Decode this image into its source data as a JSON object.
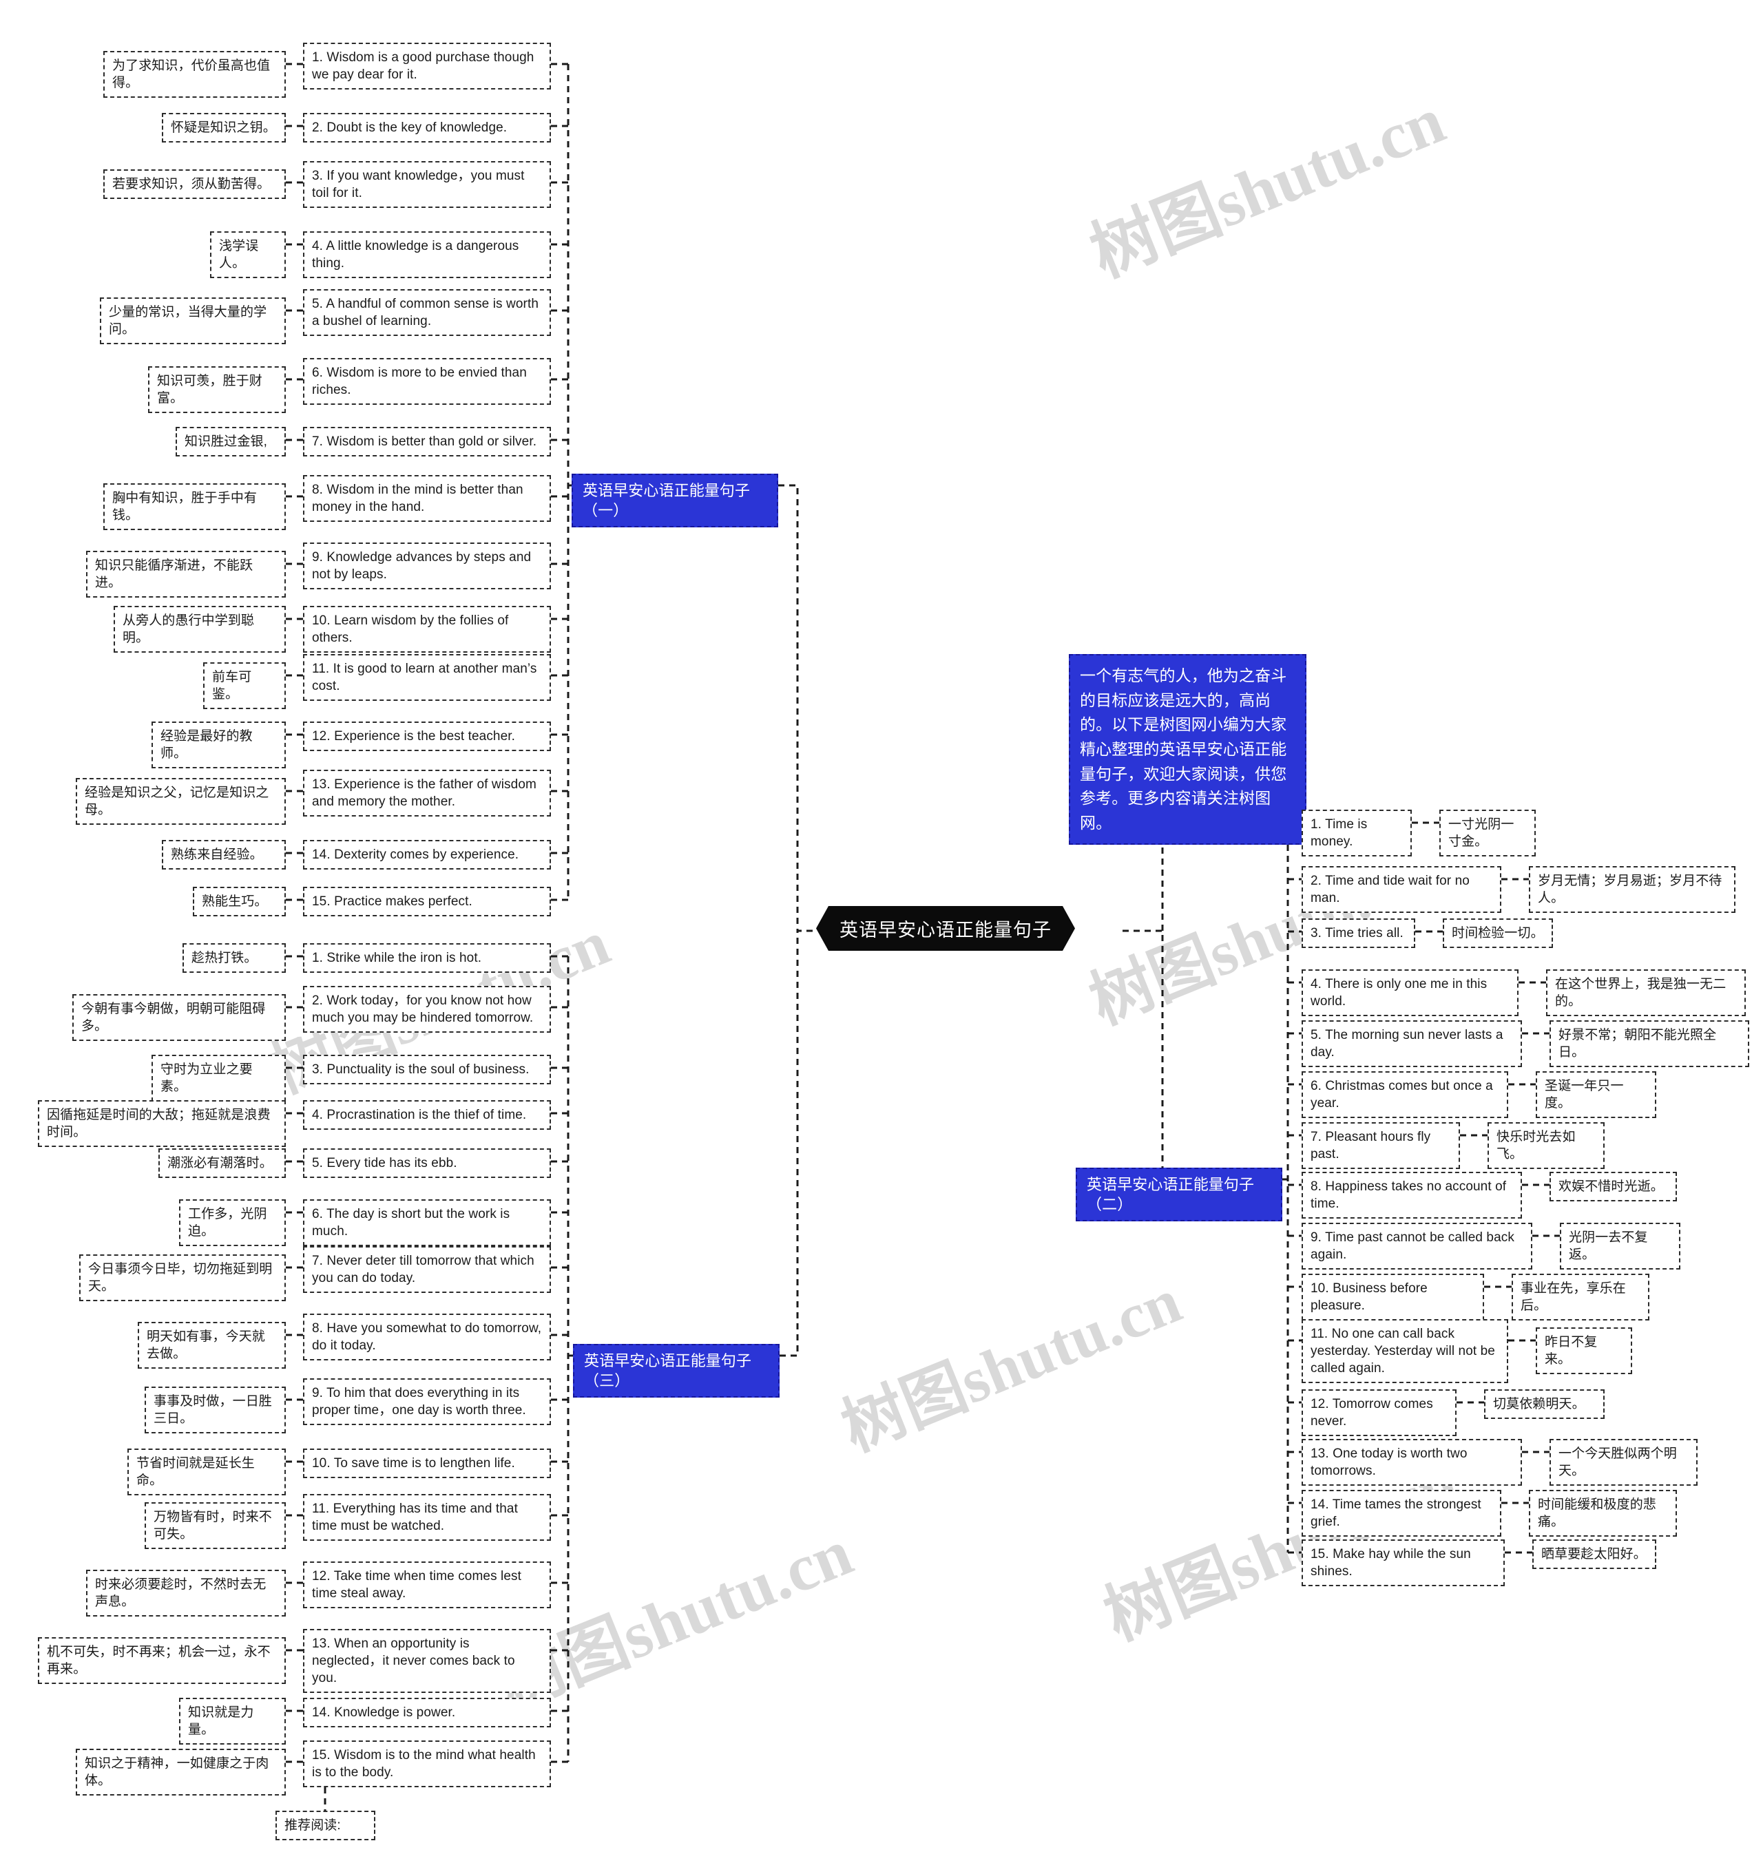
{
  "root": {
    "label": "英语早安心语正能量句子"
  },
  "description": {
    "text": "一个有志气的人，他为之奋斗的目标应该是远大的，高尚的。以下是树图网小编为大家精心整理的英语早安心语正能量句子，欢迎大家阅读，供您参考。更多内容请关注树图网。"
  },
  "branches": [
    {
      "label": "英语早安心语正能量句子（一）"
    },
    {
      "label": "英语早安心语正能量句子（二）"
    },
    {
      "label": "英语早安心语正能量句子（三）"
    }
  ],
  "watermarks": [
    "树图shutu.cn",
    "树图shutu.cn",
    "树图shutu.cn",
    "树图shutu.cn",
    "树图shutu.cn",
    "树图shutu.cn"
  ],
  "part_one": [
    {
      "en": "1. Wisdom is a good purchase though we pay dear for it.",
      "cn": "为了求知识，代价虽高也值得。"
    },
    {
      "en": "2. Doubt is the key of knowledge.",
      "cn": "怀疑是知识之钥。"
    },
    {
      "en": "3. If you want knowledge，you must toil for it.",
      "cn": "若要求知识，须从勤苦得。"
    },
    {
      "en": "4. A little knowledge is a dangerous thing.",
      "cn": "浅学误人。"
    },
    {
      "en": "5. A handful of common sense is worth a bushel of learning.",
      "cn": "少量的常识，当得大量的学问。"
    },
    {
      "en": "6. Wisdom is more to be envied than riches.",
      "cn": "知识可羡，胜于财富。"
    },
    {
      "en": "7. Wisdom is better than gold or silver.",
      "cn": "知识胜过金银,"
    },
    {
      "en": "8. Wisdom in the mind is better than money in the hand.",
      "cn": "胸中有知识，胜于手中有钱。"
    },
    {
      "en": "9. Knowledge advances by steps and not by leaps.",
      "cn": "知识只能循序渐进，不能跃进。"
    },
    {
      "en": "10. Learn wisdom by the follies of others.",
      "cn": "从旁人的愚行中学到聪明。"
    },
    {
      "en": "11. It is good to learn at another man’s cost.",
      "cn": "前车可鉴。"
    },
    {
      "en": "12. Experience is the best teacher.",
      "cn": "经验是最好的教师。"
    },
    {
      "en": "13. Experience is the father of wisdom and memory the mother.",
      "cn": "经验是知识之父，记忆是知识之母。"
    },
    {
      "en": "14. Dexterity comes by experience.",
      "cn": "熟练来自经验。"
    },
    {
      "en": "15. Practice makes perfect.",
      "cn": "熟能生巧。"
    }
  ],
  "part_three": [
    {
      "en": "1. Strike while the iron is hot.",
      "cn": "趁热打铁。"
    },
    {
      "en": "2. Work today，for you know not how much you may be hindered tomorrow.",
      "cn": "今朝有事今朝做，明朝可能阻碍多。"
    },
    {
      "en": "3. Punctuality is the soul of business.",
      "cn": "守时为立业之要素。"
    },
    {
      "en": "4. Procrastination is the thief of time.",
      "cn": "因循拖延是时间的大敌；拖延就是浪费时间。"
    },
    {
      "en": "5. Every tide has its ebb.",
      "cn": "潮涨必有潮落时。"
    },
    {
      "en": "6. The day is short but the work is much.",
      "cn": "工作多，光阴迫。"
    },
    {
      "en": "7. Never deter till tomorrow that which you can do today.",
      "cn": "今日事须今日毕，切勿拖延到明天。"
    },
    {
      "en": "8. Have you somewhat to do tomorrow, do it today.",
      "cn": "明天如有事，今天就去做。"
    },
    {
      "en": "9. To him that does everything in its proper time，one day is worth three.",
      "cn": "事事及时做，一日胜三日。"
    },
    {
      "en": "10. To save time is to lengthen life.",
      "cn": "节省时间就是延长生命。"
    },
    {
      "en": "11. Everything has its time and that time must be watched.",
      "cn": "万物皆有时，时来不可失。"
    },
    {
      "en": "12. Take time when time comes lest time steal away.",
      "cn": "时来必须要趁时，不然时去无声息。"
    },
    {
      "en": "13. When an opportunity is neglected，it never comes back to you.",
      "cn": "机不可失，时不再来；机会一过，永不再来。"
    },
    {
      "en": "14. Knowledge is power.",
      "cn": "知识就是力量。"
    },
    {
      "en": "15. Wisdom is to the mind what health is to the body.",
      "cn": "知识之于精神，一如健康之于肉体。"
    }
  ],
  "part_three_footer": {
    "label": "推荐阅读:"
  },
  "part_two": [
    {
      "en": "1. Time is money.",
      "cn": "一寸光阴一寸金。"
    },
    {
      "en": "2. Time and tide wait for no man.",
      "cn": "岁月无情；岁月易逝；岁月不待人。"
    },
    {
      "en": "3. Time tries all.",
      "cn": "时间检验一切。"
    },
    {
      "en": "4. There is only one me in this world.",
      "cn": "在这个世界上，我是独一无二的。"
    },
    {
      "en": "5. The morning sun never lasts a day.",
      "cn": "好景不常；朝阳不能光照全日。"
    },
    {
      "en": "6. Christmas comes but once a year.",
      "cn": "圣诞一年只一度。"
    },
    {
      "en": "7. Pleasant hours fly past.",
      "cn": "快乐时光去如飞。"
    },
    {
      "en": "8. Happiness takes no account of time.",
      "cn": "欢娱不惜时光逝。"
    },
    {
      "en": "9. Time past cannot be called back again.",
      "cn": "光阴一去不复返。"
    },
    {
      "en": "10. Business before pleasure.",
      "cn": "事业在先，享乐在后。"
    },
    {
      "en": "11. No one can call back yesterday. Yesterday will not be called again.",
      "cn": "昨日不复来。"
    },
    {
      "en": "12. Tomorrow comes never.",
      "cn": "切莫依赖明天。"
    },
    {
      "en": "13. One today is worth two tomorrows.",
      "cn": "一个今天胜似两个明天。"
    },
    {
      "en": "14. Time tames the strongest grief.",
      "cn": "时间能缓和极度的悲痛。"
    },
    {
      "en": "15. Make hay while the sun shines.",
      "cn": "晒草要趁太阳好。"
    }
  ],
  "colors": {
    "accent_blue": "#2b35d6",
    "root_black": "#0b0b0b",
    "border": "#2b2b2b",
    "watermark": "#d9d9d9"
  }
}
